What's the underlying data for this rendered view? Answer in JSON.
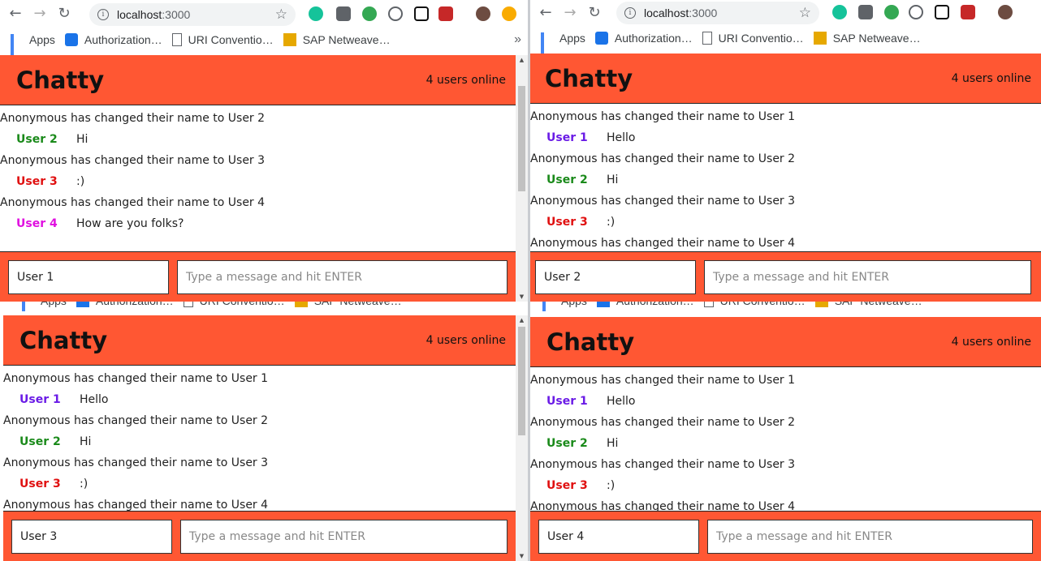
{
  "browser": {
    "url_host": "localhost",
    "url_port": ":3000",
    "bookmarks": [
      "Apps",
      "Authorization…",
      "URI Conventio…",
      "SAP Netweave…"
    ],
    "more": "»"
  },
  "app": {
    "brand": "Chatty",
    "online": "4 users online",
    "placeholder": "Type a message and hit ENTER"
  },
  "colors": {
    "accent": "#ff5733",
    "user1": "#6a1be6",
    "user2": "#1a8a1a",
    "user3": "#e01010",
    "user4": "#e010e0"
  },
  "windows": [
    {
      "username": "User 1",
      "messages": [
        {
          "type": "system",
          "text": "Anonymous has changed their name to User 2"
        },
        {
          "type": "chat",
          "user": "User 2",
          "color": "#1a8a1a",
          "text": "Hi"
        },
        {
          "type": "system",
          "text": "Anonymous has changed their name to User 3"
        },
        {
          "type": "chat",
          "user": "User 3",
          "color": "#e01010",
          "text": ":)"
        },
        {
          "type": "system",
          "text": "Anonymous has changed their name to User 4"
        },
        {
          "type": "chat",
          "user": "User 4",
          "color": "#e010e0",
          "text": "How are you folks?"
        }
      ]
    },
    {
      "username": "User 2",
      "messages": [
        {
          "type": "system",
          "text": "Anonymous has changed their name to User 1"
        },
        {
          "type": "chat",
          "user": "User 1",
          "color": "#6a1be6",
          "text": "Hello"
        },
        {
          "type": "system",
          "text": "Anonymous has changed their name to User 2"
        },
        {
          "type": "chat",
          "user": "User 2",
          "color": "#1a8a1a",
          "text": "Hi"
        },
        {
          "type": "system",
          "text": "Anonymous has changed their name to User 3"
        },
        {
          "type": "chat",
          "user": "User 3",
          "color": "#e01010",
          "text": ":)"
        },
        {
          "type": "system",
          "text": "Anonymous has changed their name to User 4"
        }
      ]
    },
    {
      "username": "User 3",
      "messages": [
        {
          "type": "system",
          "text": "Anonymous has changed their name to User 1"
        },
        {
          "type": "chat",
          "user": "User 1",
          "color": "#6a1be6",
          "text": "Hello"
        },
        {
          "type": "system",
          "text": "Anonymous has changed their name to User 2"
        },
        {
          "type": "chat",
          "user": "User 2",
          "color": "#1a8a1a",
          "text": "Hi"
        },
        {
          "type": "system",
          "text": "Anonymous has changed their name to User 3"
        },
        {
          "type": "chat",
          "user": "User 3",
          "color": "#e01010",
          "text": ":)"
        },
        {
          "type": "system",
          "text": "Anonymous has changed their name to User 4"
        }
      ]
    },
    {
      "username": "User 4",
      "messages": [
        {
          "type": "system",
          "text": "Anonymous has changed their name to User 1"
        },
        {
          "type": "chat",
          "user": "User 1",
          "color": "#6a1be6",
          "text": "Hello"
        },
        {
          "type": "system",
          "text": "Anonymous has changed their name to User 2"
        },
        {
          "type": "chat",
          "user": "User 2",
          "color": "#1a8a1a",
          "text": "Hi"
        },
        {
          "type": "system",
          "text": "Anonymous has changed their name to User 3"
        },
        {
          "type": "chat",
          "user": "User 3",
          "color": "#e01010",
          "text": ":)"
        },
        {
          "type": "system",
          "text": "Anonymous has changed their name to User 4"
        }
      ]
    }
  ]
}
